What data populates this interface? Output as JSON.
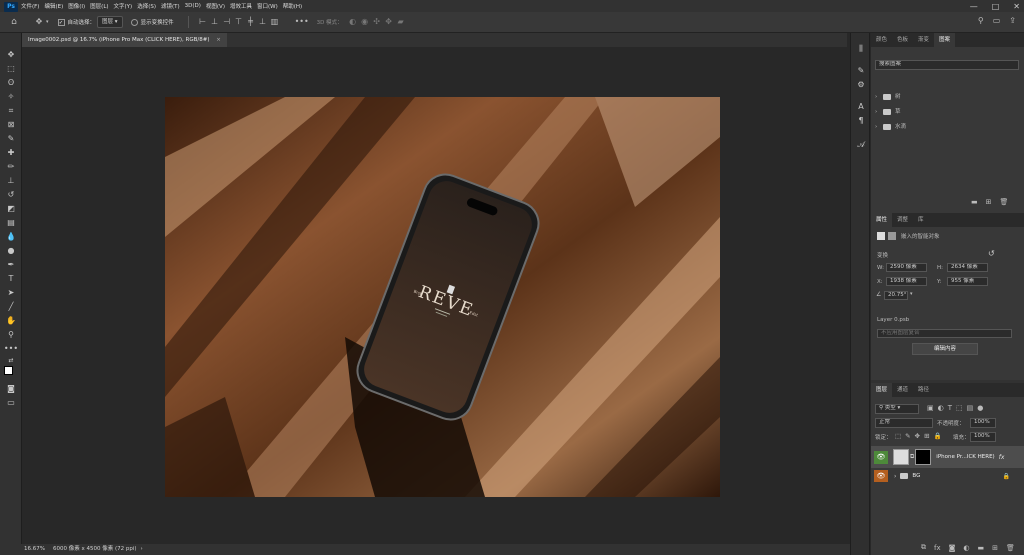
{
  "app": {
    "logo": "Ps"
  },
  "menu": [
    "文件(F)",
    "编辑(E)",
    "图像(I)",
    "图层(L)",
    "文字(Y)",
    "选择(S)",
    "滤镜(T)",
    "3D(D)",
    "视图(V)",
    "增效工具",
    "窗口(W)",
    "帮助(H)"
  ],
  "options": {
    "auto_select_label": "自动选择：",
    "auto_select_value": "图层",
    "show_transform_label": "显示变换控件",
    "mode_label": "3D 模式："
  },
  "document": {
    "tab_title": "Image0002.psd @ 16.7% (iPhone Pro Max (CLICK HERE), RGB/8#)",
    "mockup_brand": "REVE",
    "mockup_left": "Brst",
    "mockup_right": "Edst"
  },
  "status": {
    "zoom": "16.67%",
    "doc_info": "6000 像素 x 4500 像素 (72 ppi)"
  },
  "libraries_panel": {
    "tabs": [
      "颜色",
      "色板",
      "渐变",
      "图案"
    ],
    "active_tab": "图案",
    "search_placeholder": "搜索图案",
    "groups": [
      "树",
      "草",
      "水滴"
    ]
  },
  "properties_panel": {
    "tabs": [
      "属性",
      "调整",
      "库"
    ],
    "object_type": "嵌入的智能对象",
    "transform_title": "变换",
    "w_label": "W:",
    "w_value": "2590 像素",
    "h_label": "H:",
    "h_value": "2634 像素",
    "x_label": "X:",
    "x_value": "1938 像素",
    "y_label": "Y:",
    "y_value": "955 像素",
    "angle_value": "20.75°",
    "file_name": "Layer 0.psb",
    "comp_placeholder": "不应用图层复合",
    "edit_button": "编辑内容"
  },
  "layers_panel": {
    "tabs": [
      "图层",
      "通道",
      "路径"
    ],
    "filter_kind": "类型",
    "blend_mode": "正常",
    "opacity_label": "不透明度：",
    "opacity_value": "100%",
    "lock_label": "锁定：",
    "fill_label": "填充：",
    "fill_value": "100%",
    "layers": [
      {
        "name": "iPhone Pr...ICK HERE)",
        "fx": "fx"
      },
      {
        "name": "BG"
      }
    ]
  },
  "colors": {
    "accent": "#31a8ff",
    "eye_green": "#4d8a3a",
    "eye_orange": "#b45f1f"
  }
}
